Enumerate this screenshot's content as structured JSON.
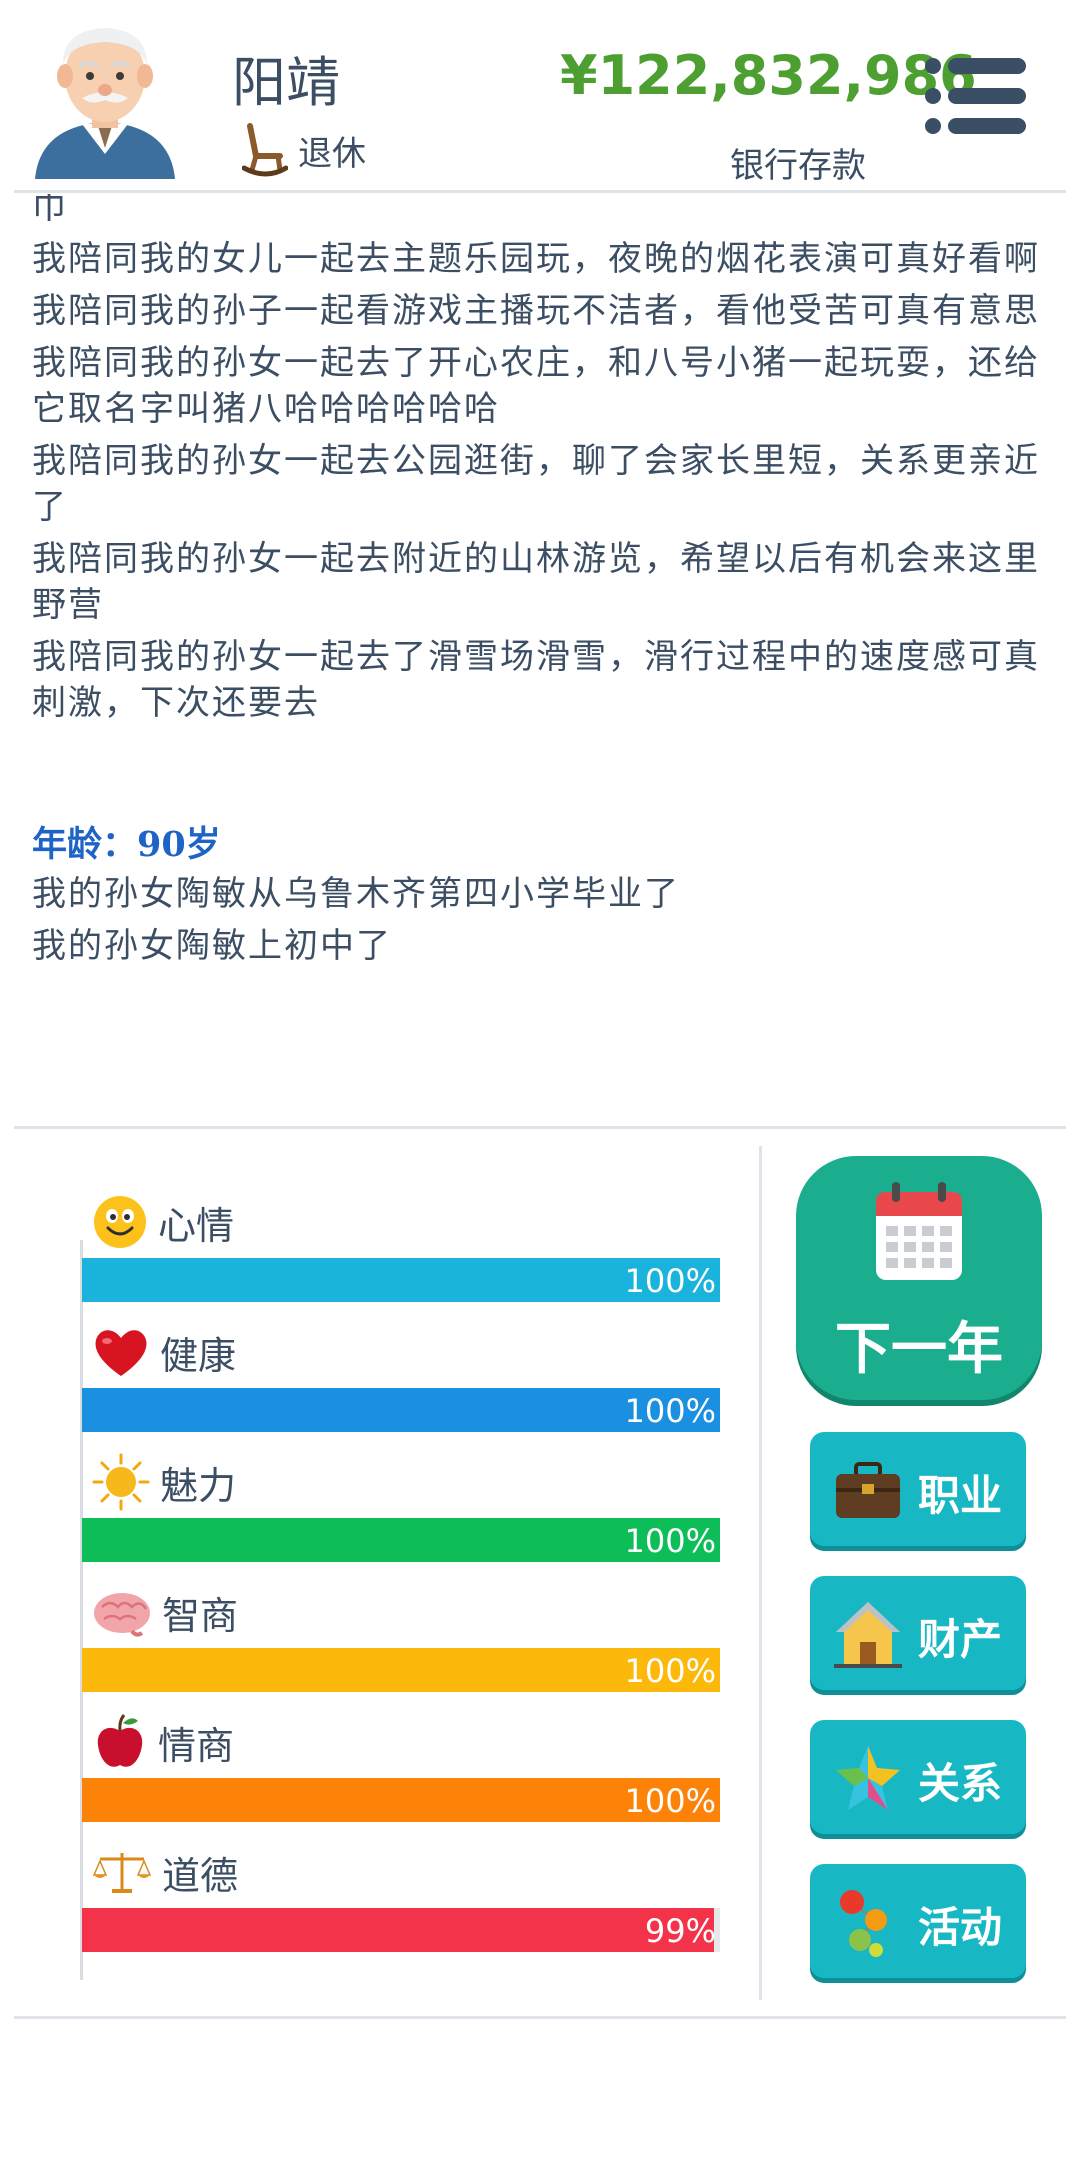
{
  "header": {
    "name": "阳靖",
    "status": "退休",
    "money": "¥122,832,986",
    "money_label": "银行存款"
  },
  "log": {
    "entries_top": [
      "巾",
      "我陪同我的女儿一起去主题乐园玩，夜晚的烟花表演可真好看啊",
      "我陪同我的孙子一起看游戏主播玩不洁者，看他受苦可真有意思",
      "我陪同我的孙女一起去了开心农庄，和八号小猪一起玩耍，还给它取名字叫猪八哈哈哈哈哈哈",
      "我陪同我的孙女一起去公园逛街，聊了会家长里短，关系更亲近了",
      "我陪同我的孙女一起去附近的山林游览，希望以后有机会来这里野营",
      "我陪同我的孙女一起去了滑雪场滑雪，滑行过程中的速度感可真刺激，下次还要去"
    ],
    "age_heading": "年龄：90岁",
    "entries_bottom": [
      "我的孙女陶敏从乌鲁木齐第四小学毕业了",
      "我的孙女陶敏上初中了"
    ]
  },
  "stats": [
    {
      "label": "心情",
      "value": 100,
      "display": "100%",
      "color": "#1ab3dc",
      "icon": "smiley-icon"
    },
    {
      "label": "健康",
      "value": 100,
      "display": "100%",
      "color": "#1b8fe0",
      "icon": "heart-icon"
    },
    {
      "label": "魅力",
      "value": 100,
      "display": "100%",
      "color": "#0dbd58",
      "icon": "sun-icon"
    },
    {
      "label": "智商",
      "value": 100,
      "display": "100%",
      "color": "#fdb90b",
      "icon": "brain-icon"
    },
    {
      "label": "情商",
      "value": 100,
      "display": "100%",
      "color": "#fd8208",
      "icon": "apple-icon"
    },
    {
      "label": "道德",
      "value": 99,
      "display": "99%",
      "color": "#f2334a",
      "icon": "scales-icon"
    }
  ],
  "buttons": {
    "next_year": "下一年",
    "career": "职业",
    "property": "财产",
    "relations": "关系",
    "activities": "活动"
  }
}
